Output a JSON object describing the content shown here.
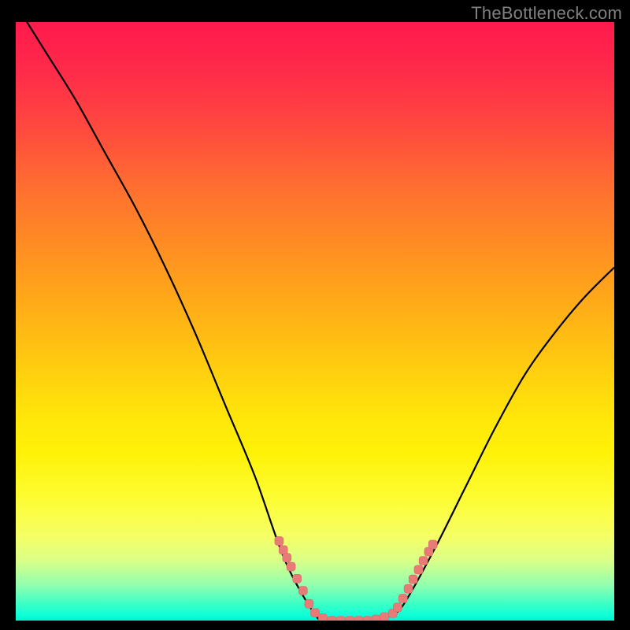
{
  "watermark": "TheBottleneck.com",
  "colors": {
    "frame": "#000000",
    "watermark_text": "#808080",
    "curve_stroke": "#000000",
    "marker_fill": "#e87a78",
    "marker_stroke": "#d86b69"
  },
  "chart_data": {
    "type": "line",
    "title": "",
    "xlabel": "",
    "ylabel": "",
    "xlim": [
      0,
      1
    ],
    "ylim": [
      0,
      1
    ],
    "grid": false,
    "series": [
      {
        "name": "bottleneck-curve",
        "x": [
          0.0,
          0.05,
          0.1,
          0.15,
          0.2,
          0.25,
          0.3,
          0.35,
          0.4,
          0.45,
          0.5,
          0.52,
          0.55,
          0.6,
          0.63,
          0.65,
          0.7,
          0.75,
          0.8,
          0.85,
          0.9,
          0.95,
          1.0
        ],
        "y": [
          1.03,
          0.95,
          0.87,
          0.78,
          0.69,
          0.59,
          0.48,
          0.36,
          0.24,
          0.1,
          0.01,
          0.0,
          0.0,
          0.0,
          0.01,
          0.03,
          0.12,
          0.22,
          0.32,
          0.41,
          0.48,
          0.54,
          0.59
        ]
      }
    ],
    "markers": [
      {
        "x": 0.44,
        "y": 0.133
      },
      {
        "x": 0.447,
        "y": 0.118
      },
      {
        "x": 0.453,
        "y": 0.105
      },
      {
        "x": 0.46,
        "y": 0.09
      },
      {
        "x": 0.47,
        "y": 0.07
      },
      {
        "x": 0.48,
        "y": 0.05
      },
      {
        "x": 0.49,
        "y": 0.028
      },
      {
        "x": 0.5,
        "y": 0.013
      },
      {
        "x": 0.513,
        "y": 0.004
      },
      {
        "x": 0.528,
        "y": 0.0
      },
      {
        "x": 0.543,
        "y": 0.0
      },
      {
        "x": 0.558,
        "y": 0.0
      },
      {
        "x": 0.573,
        "y": 0.0
      },
      {
        "x": 0.588,
        "y": 0.0
      },
      {
        "x": 0.602,
        "y": 0.002
      },
      {
        "x": 0.616,
        "y": 0.006
      },
      {
        "x": 0.63,
        "y": 0.012
      },
      {
        "x": 0.638,
        "y": 0.022
      },
      {
        "x": 0.647,
        "y": 0.037
      },
      {
        "x": 0.656,
        "y": 0.053
      },
      {
        "x": 0.664,
        "y": 0.069
      },
      {
        "x": 0.673,
        "y": 0.085
      },
      {
        "x": 0.681,
        "y": 0.1
      },
      {
        "x": 0.69,
        "y": 0.115
      },
      {
        "x": 0.697,
        "y": 0.127
      }
    ],
    "annotations": []
  }
}
